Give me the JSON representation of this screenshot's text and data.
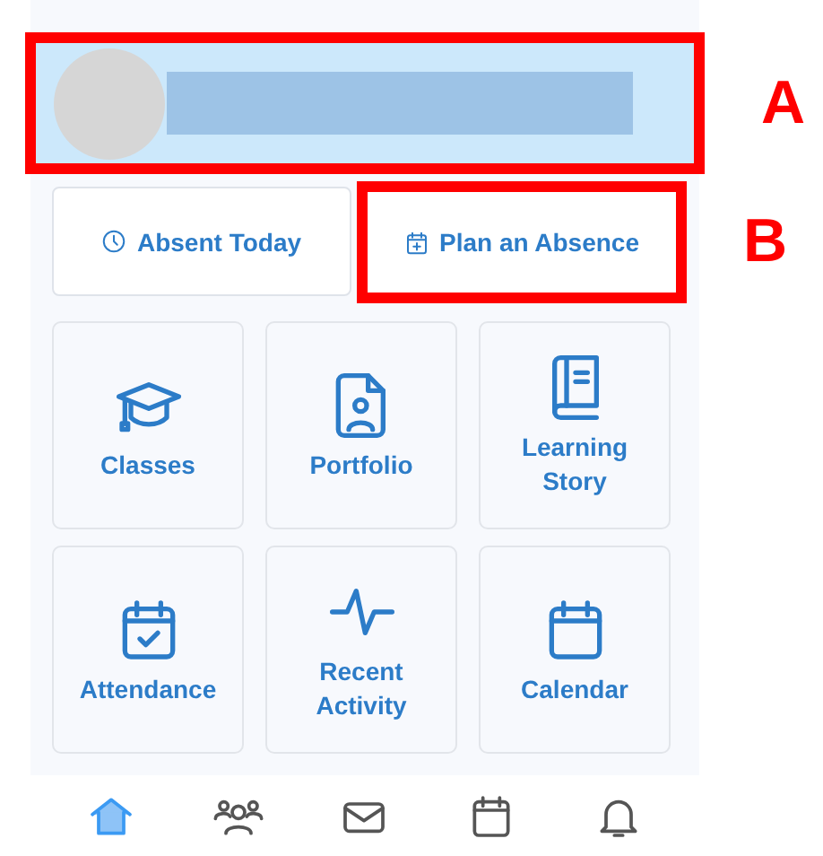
{
  "header": {
    "annotation": "A"
  },
  "actions": [
    {
      "label": "Absent Today"
    },
    {
      "label": "Plan an Absence",
      "annotation": "B"
    }
  ],
  "tiles": [
    {
      "label": "Classes"
    },
    {
      "label": "Portfolio"
    },
    {
      "label": "Learning Story"
    },
    {
      "label": "Attendance"
    },
    {
      "label": "Recent Activity"
    },
    {
      "label": "Calendar"
    }
  ],
  "nav": [
    {
      "selected": true
    },
    {
      "selected": false
    },
    {
      "selected": false
    },
    {
      "selected": false
    },
    {
      "selected": false
    }
  ]
}
